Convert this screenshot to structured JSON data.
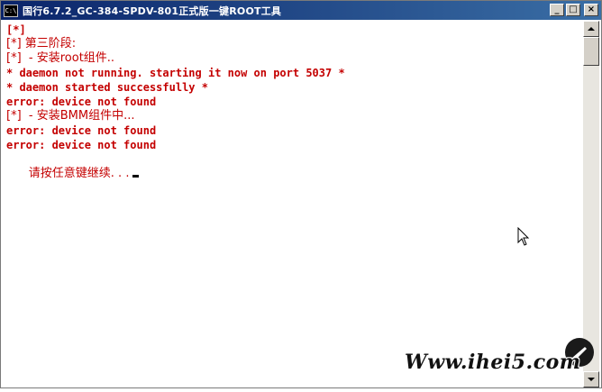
{
  "window": {
    "title": "国行6.7.2_GC-384-SPDV-801正式版一键ROOT工具",
    "icon_text": "C:\\",
    "buttons": {
      "minimize": "_",
      "maximize": "□",
      "close": "×"
    }
  },
  "console": {
    "lines": [
      "[*]",
      "[*] 第三阶段:",
      "[*]  - 安装root组件..",
      "* daemon not running. starting it now on port 5037 *",
      "* daemon started successfully *",
      "error: device not found",
      "[*]  - 安装BMM组件中...",
      "error: device not found",
      "error: device not found",
      "请按任意键继续. . ."
    ]
  },
  "watermark": {
    "text": "Www.ihei5.com"
  },
  "colors": {
    "console_text": "#c40000",
    "titlebar": "#0a246a",
    "background": "#ffffff"
  },
  "icons": {
    "app": "console-icon",
    "cursor": "mouse-pointer-icon",
    "logo": "watermark-logo-icon"
  }
}
